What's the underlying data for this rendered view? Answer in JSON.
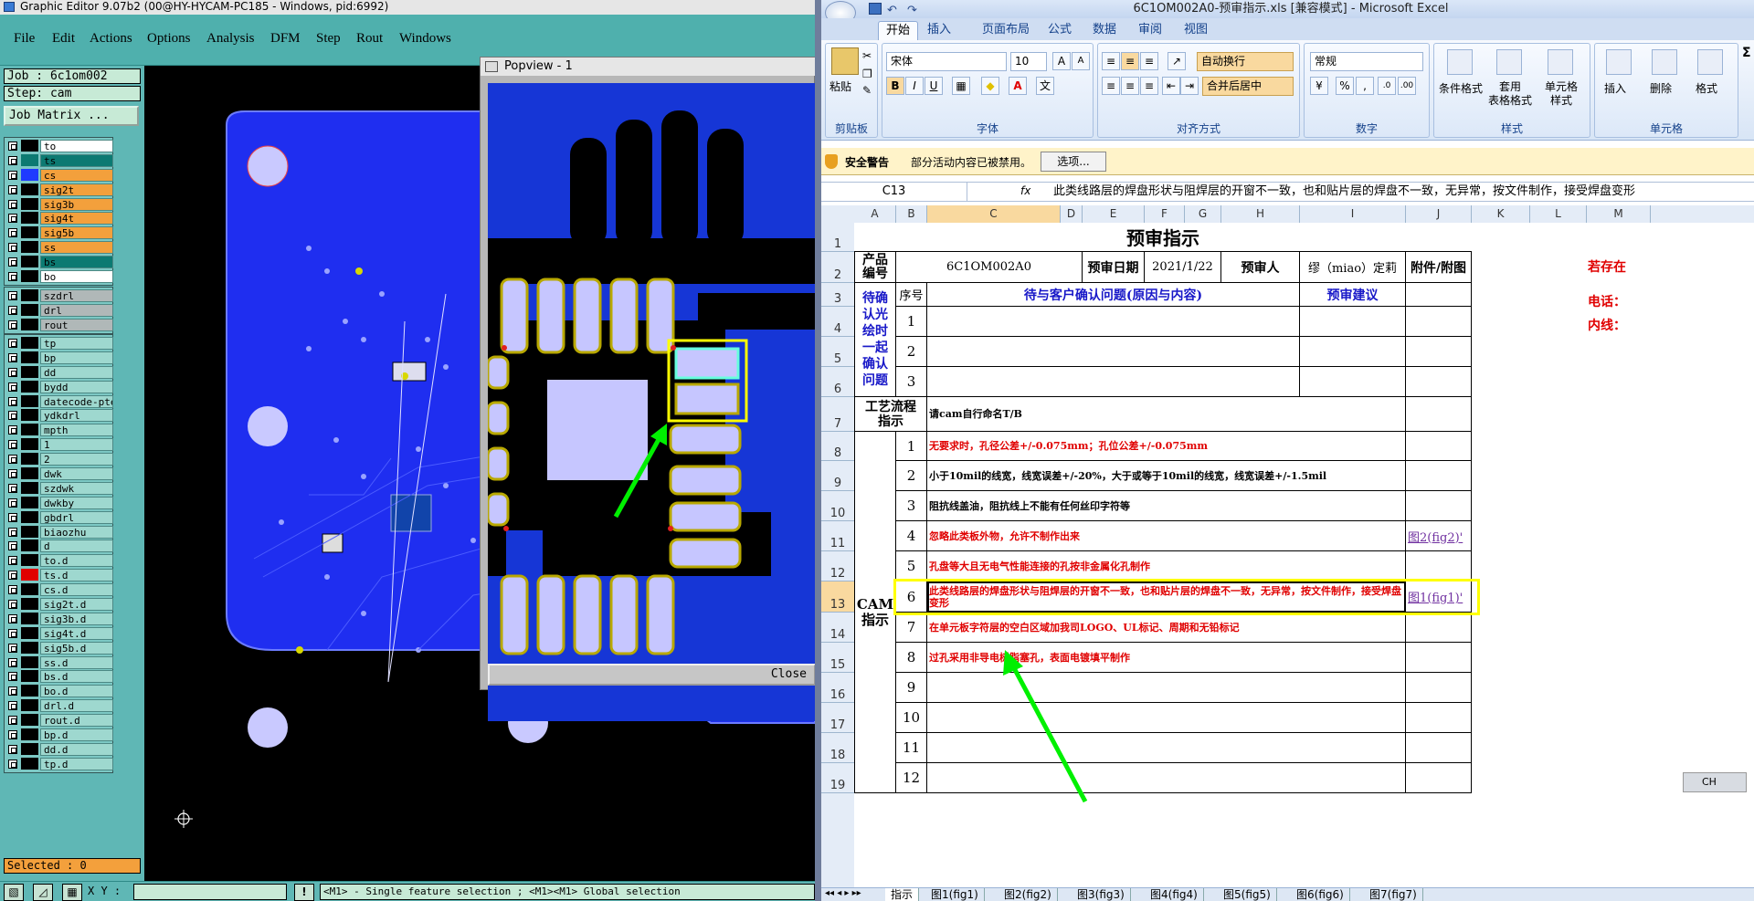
{
  "cam": {
    "title": "Graphic Editor 9.07b2 (00@HY-HYCAM-PC185 - Windows, pid:6992)",
    "menu": [
      "File",
      "Edit",
      "Actions",
      "Options",
      "Analysis",
      "DFM",
      "Step",
      "Rout",
      "Windows"
    ],
    "job_label": "Job : 6c1om002",
    "step_label": "Step: cam",
    "job_matrix": "Job Matrix ...",
    "layers_top": [
      {
        "name": "to",
        "color": "#000000",
        "bg": "#ffffff"
      },
      {
        "name": "ts",
        "color": "#0c7a72",
        "bg": "#0c7a72"
      },
      {
        "name": "cs",
        "color": "#1f3bff",
        "bg": "#f3a03c"
      },
      {
        "name": "sig2t",
        "color": "#000000",
        "bg": "#f3a03c"
      },
      {
        "name": "sig3b",
        "color": "#000000",
        "bg": "#f3a03c"
      },
      {
        "name": "sig4t",
        "color": "#000000",
        "bg": "#f3a03c"
      },
      {
        "name": "sig5b",
        "color": "#000000",
        "bg": "#f3a03c"
      },
      {
        "name": "ss",
        "color": "#000000",
        "bg": "#f3a03c"
      },
      {
        "name": "bs",
        "color": "#000000",
        "bg": "#0c7a72"
      },
      {
        "name": "bo",
        "color": "#000000",
        "bg": "#ffffff"
      }
    ],
    "layers_mid": [
      {
        "name": "szdrl"
      },
      {
        "name": "drl"
      },
      {
        "name": "rout"
      }
    ],
    "layers_bottom": [
      "tp",
      "bp",
      "dd",
      "bydd",
      "datecode-pte",
      "ydkdrl",
      "mpth",
      "1",
      "2",
      "dwk",
      "szdwk",
      "dwkby",
      "gbdrl",
      "biaozhu",
      "d",
      "to.d",
      "ts.d",
      "cs.d",
      "sig2t.d",
      "sig3b.d",
      "sig4t.d",
      "sig5b.d",
      "ss.d",
      "bs.d",
      "bo.d",
      "drl.d",
      "rout.d",
      "bp.d",
      "dd.d",
      "tp.d"
    ],
    "selected": "Selected : 0",
    "xy_label": "X Y :",
    "status_msg": "<M1> - Single feature selection ; <M1><M1> Global selection"
  },
  "popview": {
    "title": "Popview - 1",
    "close_label": "Close"
  },
  "excel": {
    "title": "6C1OM002A0-预审指示.xls  [兼容模式] - Microsoft Excel",
    "ribbon_tabs": [
      "开始",
      "插入",
      "页面布局",
      "公式",
      "数据",
      "审阅",
      "视图"
    ],
    "clipboard": {
      "paste": "粘贴",
      "label": "剪贴板"
    },
    "font": {
      "name": "宋体",
      "size": "10",
      "label": "字体"
    },
    "align": {
      "wrap": "自动换行",
      "merge": "合并后居中",
      "label": "对齐方式"
    },
    "number": {
      "format": "常规",
      "label": "数字"
    },
    "styles": {
      "cond": "条件格式",
      "table": "套用\n表格格式",
      "cell": "单元格\n样式",
      "label": "样式"
    },
    "cells": {
      "insert": "插入",
      "delete": "删除",
      "format": "格式",
      "label": "单元格"
    },
    "security": {
      "title": "安全警告",
      "message": "部分活动内容已被禁用。",
      "options": "选项..."
    },
    "name_box": "C13",
    "fx": "fx",
    "formula": "此类线路层的焊盘形状与阻焊层的开窗不一致，也和贴片层的焊盘不一致，无异常，按文件制作，接受焊盘变形",
    "columns": [
      "A",
      "B",
      "C",
      "D",
      "E",
      "F",
      "G",
      "H",
      "I",
      "J",
      "K",
      "L",
      "M"
    ],
    "rows": [
      "1",
      "2",
      "3",
      "4",
      "5",
      "6",
      "7",
      "8",
      "9",
      "10",
      "11",
      "12",
      "13",
      "14",
      "15",
      "16",
      "17",
      "18",
      "19"
    ],
    "sheet": {
      "title": "预审指示",
      "product_no_label": "产品\n编号",
      "product_no": "6C1OM002A0",
      "review_date_label": "预审日期",
      "review_date": "2021/1/22",
      "reviewer_label": "预审人",
      "reviewer": "缪（miao）定莉",
      "attach_label": "附件/附图",
      "side1": "若存在",
      "side2": "电话：",
      "side3": "内线：",
      "pending_label": "待确认光绘时一起确认问题",
      "seq_label": "序号",
      "question_label": "待与客户确认问题(原因与内容)",
      "suggest_label": "预审建议",
      "process_label": "工艺流程指示",
      "process_text": "请cam自行命名T/B",
      "cam_label": "CAM\n指示",
      "instructions": [
        {
          "n": "1",
          "text": "无要求时，孔径公差+/-0.075mm；孔位公差+/-0.075mm",
          "style": "red",
          "link": ""
        },
        {
          "n": "2",
          "text": "小于10mil的线宽，线宽误差+/-20%，大于或等于10mil的线宽，线宽误差+/-1.5mil",
          "style": "blk",
          "link": ""
        },
        {
          "n": "3",
          "text": "阻抗线盖油，阻抗线上不能有任何丝印字符等",
          "style": "blk",
          "link": ""
        },
        {
          "n": "4",
          "text": "忽略此类板外物，允许不制作出来",
          "style": "red",
          "link": "图2(fig2)'"
        },
        {
          "n": "5",
          "text": "孔盘等大且无电气性能连接的孔按非金属化孔制作",
          "style": "red",
          "link": ""
        },
        {
          "n": "6",
          "text": "此类线路层的焊盘形状与阻焊层的开窗不一致，也和贴片层的焊盘不一致，无异常，按文件制作，接受焊盘变形",
          "style": "red",
          "link": "图1(fig1)'"
        },
        {
          "n": "7",
          "text": "在单元板字符层的空白区域加我司LOGO、UL标记、周期和无铅标记",
          "style": "red",
          "link": ""
        },
        {
          "n": "8",
          "text": "过孔采用非导电树脂塞孔，表面电镀填平制作",
          "style": "red",
          "link": ""
        },
        {
          "n": "9",
          "text": "",
          "style": "blk",
          "link": ""
        },
        {
          "n": "10",
          "text": "",
          "style": "blk",
          "link": ""
        },
        {
          "n": "11",
          "text": "",
          "style": "blk",
          "link": ""
        },
        {
          "n": "12",
          "text": "",
          "style": "blk",
          "link": ""
        }
      ],
      "pending_nums": [
        "1",
        "2",
        "3"
      ]
    },
    "sheet_tabs": [
      "指示",
      "图1(fig1)",
      "图2(fig2)",
      "图3(fig3)",
      "图4(fig4)",
      "图5(fig5)",
      "图6(fig6)",
      "图7(fig7)"
    ],
    "ime": "CH"
  }
}
